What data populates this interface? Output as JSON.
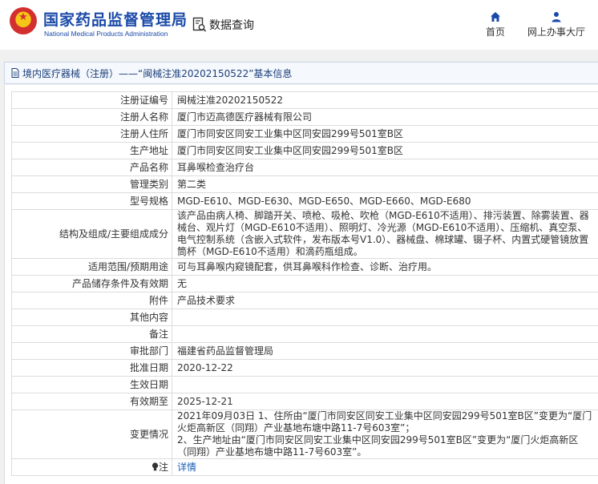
{
  "header": {
    "logo_cn": "国家药品监督管理局",
    "logo_en": "National Medical Products Administration",
    "query_label": "数据查询",
    "nav": [
      {
        "label": "首页",
        "icon": "home-icon"
      },
      {
        "label": "网上办事大厅",
        "icon": "user-icon"
      }
    ]
  },
  "page_title": "境内医疗器械（注册）——“闽械注准20202150522”基本信息",
  "fields": [
    {
      "label": "注册证编号",
      "value": "闽械注准20202150522"
    },
    {
      "label": "注册人名称",
      "value": "厦门市迈高德医疗器械有限公司"
    },
    {
      "label": "注册人住所",
      "value": "厦门市同安区同安工业集中区同安园299号501室B区"
    },
    {
      "label": "生产地址",
      "value": "厦门市同安区同安工业集中区同安园299号501室B区"
    },
    {
      "label": "产品名称",
      "value": "耳鼻喉检查治疗台"
    },
    {
      "label": "管理类别",
      "value": "第二类"
    },
    {
      "label": "型号规格",
      "value": "MGD-E610、MGD-E630、MGD-E650、MGD-E660、MGD-E680"
    },
    {
      "label": "结构及组成/主要组成成分",
      "value": "该产品由病人椅、脚踏开关、喷枪、吸枪、吹枪（MGD-E610不适用）、排污装置、除雾装置、器械台、观片灯（MGD-E610不适用）、照明灯、冷光源（MGD-E610不适用）、压缩机、真空泵、电气控制系统（含嵌入式软件，发布版本号V1.0）、器械盘、棉球罐、镊子杯、内置式硬管镜放置筒杯（MGD-E610不适用）和滴药瓶组成。"
    },
    {
      "label": "适用范围/预期用途",
      "value": "可与耳鼻喉内窥镜配套，供耳鼻喉科作检查、诊断、治疗用。"
    },
    {
      "label": "产品储存条件及有效期",
      "value": "无"
    },
    {
      "label": "附件",
      "value": "产品技术要求"
    },
    {
      "label": "其他内容",
      "value": ""
    },
    {
      "label": "备注",
      "value": ""
    },
    {
      "label": "审批部门",
      "value": "福建省药品监督管理局"
    },
    {
      "label": "批准日期",
      "value": "2020-12-22"
    },
    {
      "label": "生效日期",
      "value": ""
    },
    {
      "label": "有效期至",
      "value": "2025-12-21"
    },
    {
      "label": "变更情况",
      "value": "2021年09月03日 1、住所由“厦门市同安区同安工业集中区同安园299号501室B区”变更为“厦门火炬高新区（同翔）产业基地布塘中路11-7号603室”；\n2、生产地址由“厦门市同安区同安工业集中区同安园299号501室B区”变更为“厦门火炬高新区（同翔）产业基地布塘中路11-7号603室”。"
    }
  ],
  "note": {
    "label": "注",
    "link": "详情",
    "icon": "bulb-icon"
  }
}
